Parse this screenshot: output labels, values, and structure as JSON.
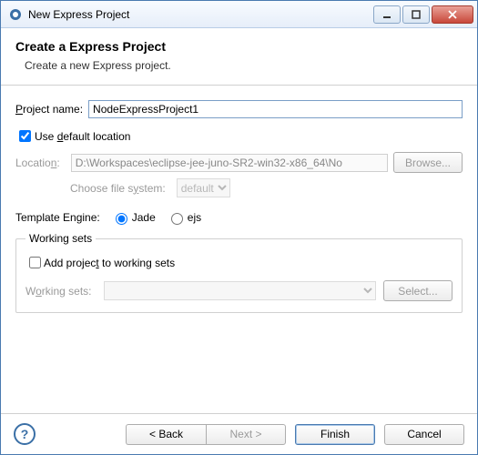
{
  "window": {
    "title": "New Express Project"
  },
  "header": {
    "title": "Create a Express Project",
    "subtitle": "Create a new Express project."
  },
  "form": {
    "project_name_label": "Project name:",
    "project_name_value": "NodeExpressProject1",
    "use_default_label_pre": "Use ",
    "use_default_label_mn": "d",
    "use_default_label_post": "efault location",
    "use_default_checked": true,
    "location_label_pre": "Locatio",
    "location_label_mn": "n",
    "location_label_post": ":",
    "location_value": "D:\\Workspaces\\eclipse-jee-juno-SR2-win32-x86_64\\No",
    "browse_label_pre": "B",
    "browse_label_mn": "r",
    "browse_label_post": "owse...",
    "fs_label_pre": "Choose file s",
    "fs_label_mn": "y",
    "fs_label_post": "stem:",
    "fs_value": "default",
    "template_label": "Template Engine:",
    "template_options": {
      "jade": "Jade",
      "ejs": "ejs"
    },
    "template_selected": "jade"
  },
  "working_sets": {
    "legend": "Working sets",
    "add_label_pre": "Add projec",
    "add_label_mn": "t",
    "add_label_post": " to working sets",
    "add_checked": false,
    "list_label_pre": "W",
    "list_label_mn": "o",
    "list_label_post": "rking sets:",
    "select_label_pre": "S",
    "select_label_mn": "e",
    "select_label_post": "lect..."
  },
  "footer": {
    "back": "< Back",
    "next": "Next >",
    "finish": "Finish",
    "cancel": "Cancel"
  }
}
